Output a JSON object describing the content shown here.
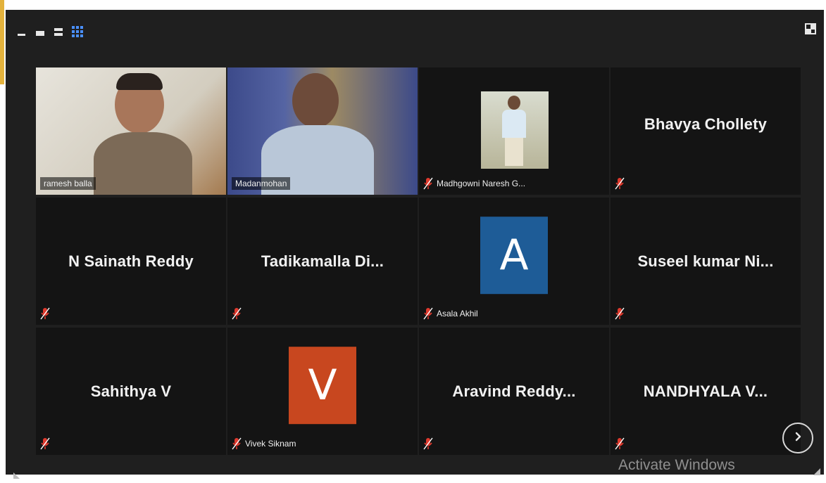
{
  "view_toolbar": {
    "buttons": [
      {
        "name": "minimize-view-icon",
        "active": false
      },
      {
        "name": "speaker-view-icon",
        "active": false
      },
      {
        "name": "list-view-icon",
        "active": false
      },
      {
        "name": "gallery-grid-icon",
        "active": true
      }
    ],
    "corner_icon": "layout-icon"
  },
  "tiles": [
    {
      "type": "video",
      "label": "ramesh balla",
      "muted": false,
      "active": true
    },
    {
      "type": "video",
      "label": "Madanmohan",
      "muted": false,
      "active": false
    },
    {
      "type": "photo",
      "label": "Madhgowni Naresh G...",
      "muted": true,
      "active": false
    },
    {
      "type": "name",
      "name": "Bhavya Chollety",
      "muted": true
    },
    {
      "type": "name",
      "name": "N Sainath Reddy",
      "muted": true
    },
    {
      "type": "name",
      "name": "Tadikamalla  Di...",
      "muted": true
    },
    {
      "type": "avatar",
      "letter": "A",
      "label": "Asala Akhil",
      "color": "#1e5c97",
      "muted": true
    },
    {
      "type": "name",
      "name": "Suseel kumar  Ni...",
      "muted": true
    },
    {
      "type": "name",
      "name": "Sahithya V",
      "muted": true
    },
    {
      "type": "avatar",
      "letter": "V",
      "label": "Vivek Siknam",
      "color": "#c8471f",
      "muted": true
    },
    {
      "type": "name",
      "name": "Aravind  Reddy...",
      "muted": true
    },
    {
      "type": "name",
      "name": "NANDHYALA  V...",
      "muted": true
    }
  ],
  "next_page_icon": "chevron-right-icon",
  "watermark": "Activate Windows",
  "colors": {
    "background": "#1f1f1f",
    "tile": "#141414",
    "active_border": "#c4d94f",
    "muted_mic": "#e03a2e"
  }
}
